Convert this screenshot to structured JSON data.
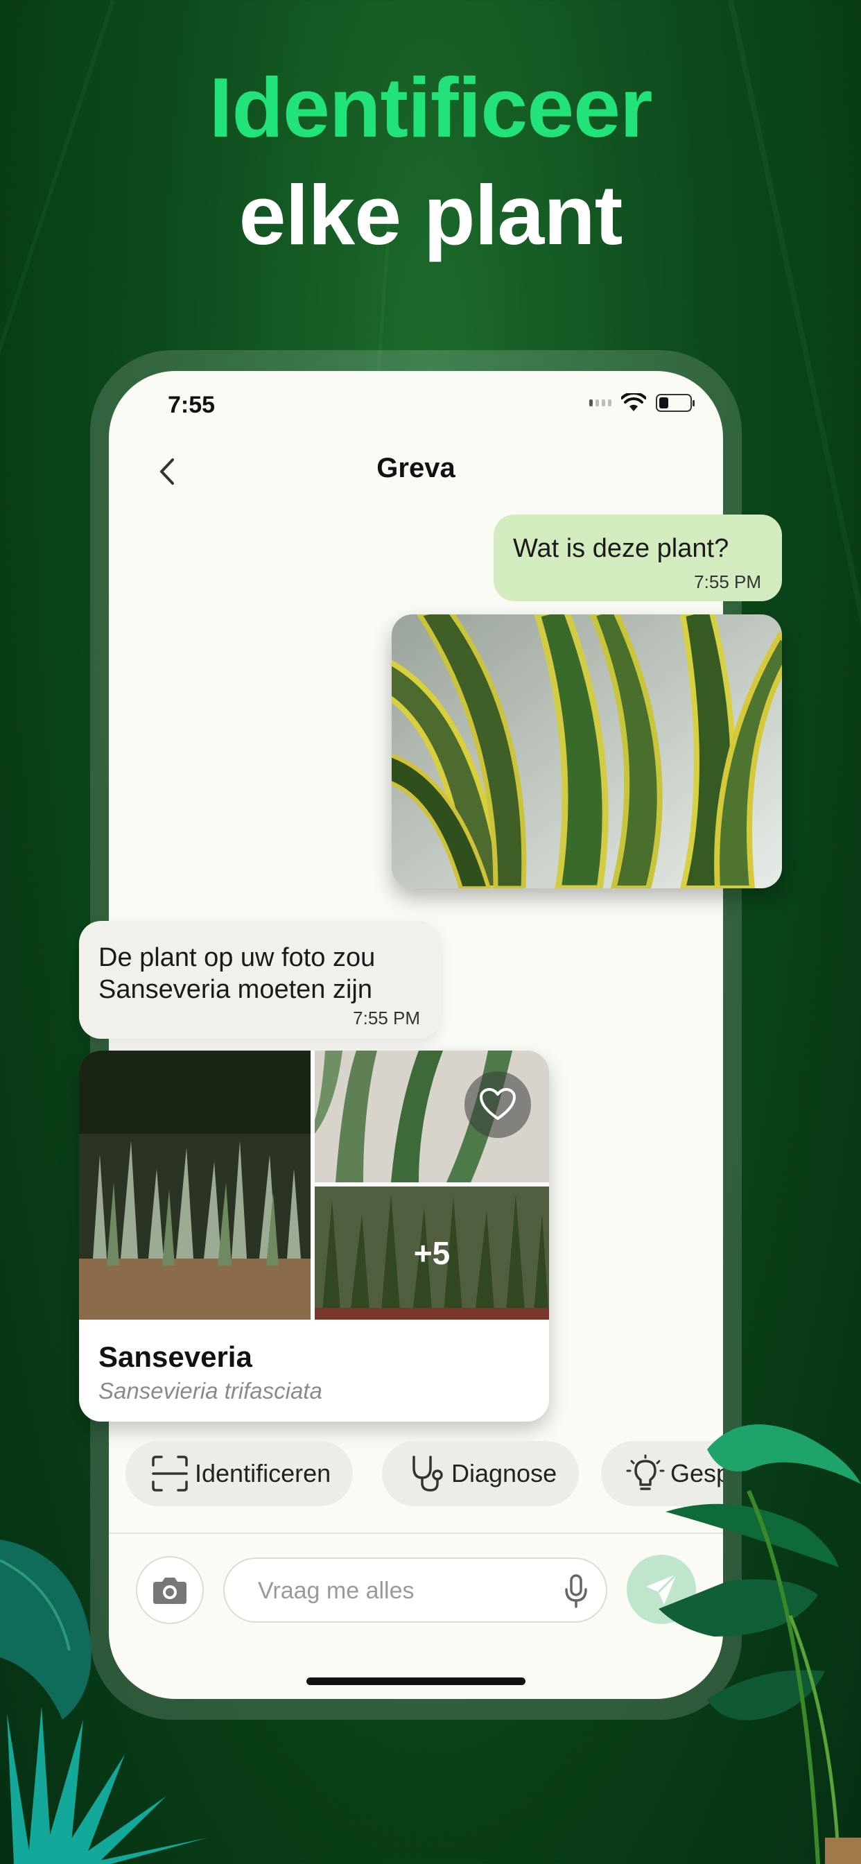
{
  "headline": {
    "line1": "Identificeer",
    "line2": "elke plant"
  },
  "status_bar": {
    "time": "7:55"
  },
  "nav": {
    "title": "Greva"
  },
  "messages": {
    "user": {
      "text": "Wat is deze plant?",
      "time": "7:55 PM"
    },
    "bot": {
      "line1": "De plant op uw foto zou",
      "line2": "Sanseveria moeten zijn",
      "time": "7:55 PM"
    }
  },
  "result": {
    "name": "Sanseveria",
    "scientific": "Sansevieria trifasciata",
    "more_photos": "+5"
  },
  "chips": [
    {
      "label": "Identificeren",
      "icon": "scan-icon"
    },
    {
      "label": "Diagnose",
      "icon": "stethoscope-icon"
    },
    {
      "label": "Gesprek",
      "icon": "lightbulb-icon"
    }
  ],
  "composer": {
    "placeholder": "Vraag me alles"
  },
  "colors": {
    "accent_green": "#22e37a",
    "user_bubble": "#d2ebbf",
    "send_button": "#bfe6cd"
  }
}
